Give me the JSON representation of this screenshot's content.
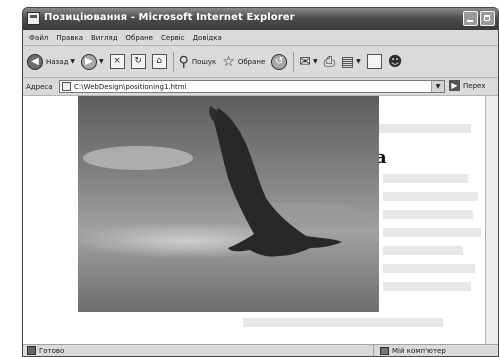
{
  "window": {
    "title": "Позиціювання - Microsoft Internet Explorer"
  },
  "menu": [
    {
      "label": "Файл"
    },
    {
      "label": "Правка"
    },
    {
      "label": "Вигляд"
    },
    {
      "label": "Обране"
    },
    {
      "label": "Сервіс"
    },
    {
      "label": "Довідка"
    }
  ],
  "toolbar": {
    "back_label": "Назад",
    "search_label": "Пошук",
    "favorites_label": "Обране"
  },
  "address": {
    "label": "Адреса",
    "value": "C:\\WebDesign\\positioning1.html",
    "go_label": "Перех"
  },
  "content": {
    "heading_fragment": "а"
  },
  "status": {
    "text": "Готово",
    "zone": "Мій комп'ютер"
  }
}
